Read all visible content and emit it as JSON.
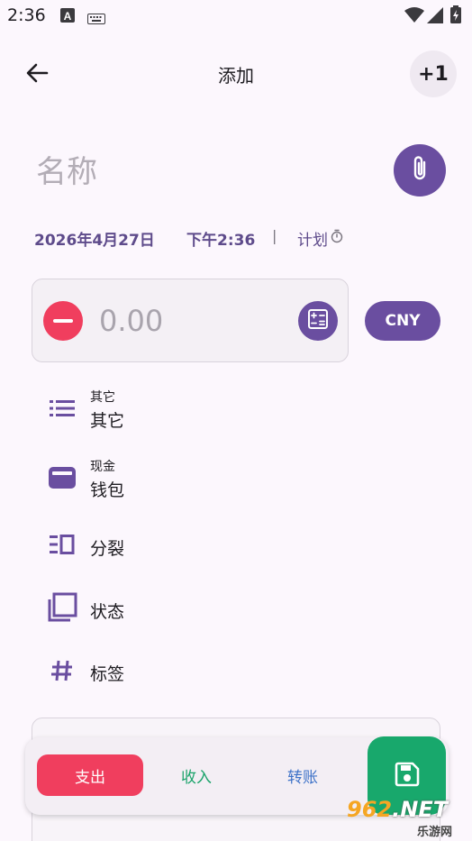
{
  "status_bar": {
    "time": "2:36",
    "icons": [
      "a-icon",
      "keyboard-icon",
      "wifi-icon",
      "signal-icon",
      "battery-charging-icon"
    ]
  },
  "app_bar": {
    "title": "添加",
    "back_icon": "arrow-left-icon",
    "plus_label": "+1"
  },
  "form": {
    "name_placeholder": "名称",
    "attach_icon": "paperclip-icon",
    "date": "2026年4月27日",
    "time": "下午2:36",
    "separator": "|",
    "plan_label": "计划",
    "plan_icon": "timer-icon",
    "amount_placeholder": "0.00",
    "calc_icon": "calculator-icon",
    "currency": "CNY"
  },
  "list": {
    "category": {
      "small": "其它",
      "main": "其它",
      "icon": "list-icon"
    },
    "account": {
      "small": "现金",
      "main": "钱包",
      "icon": "wallet-icon"
    },
    "split": {
      "main": "分裂",
      "icon": "split-icon"
    },
    "status": {
      "main": "状态",
      "icon": "status-copy-icon"
    },
    "tags": {
      "main": "标签",
      "icon": "hash-icon"
    }
  },
  "toolbar": {
    "expense": "支出",
    "income": "收入",
    "transfer": "转账",
    "save_icon": "save-icon"
  },
  "watermark": {
    "top": "962",
    "top_suffix": ".NET",
    "bottom": "乐游网"
  },
  "colors": {
    "primary": "#6a4ea0",
    "expense": "#f03e5e",
    "income": "#1aa36a",
    "transfer": "#3f73c8",
    "save": "#18a86c",
    "background": "#fcf7fd"
  }
}
